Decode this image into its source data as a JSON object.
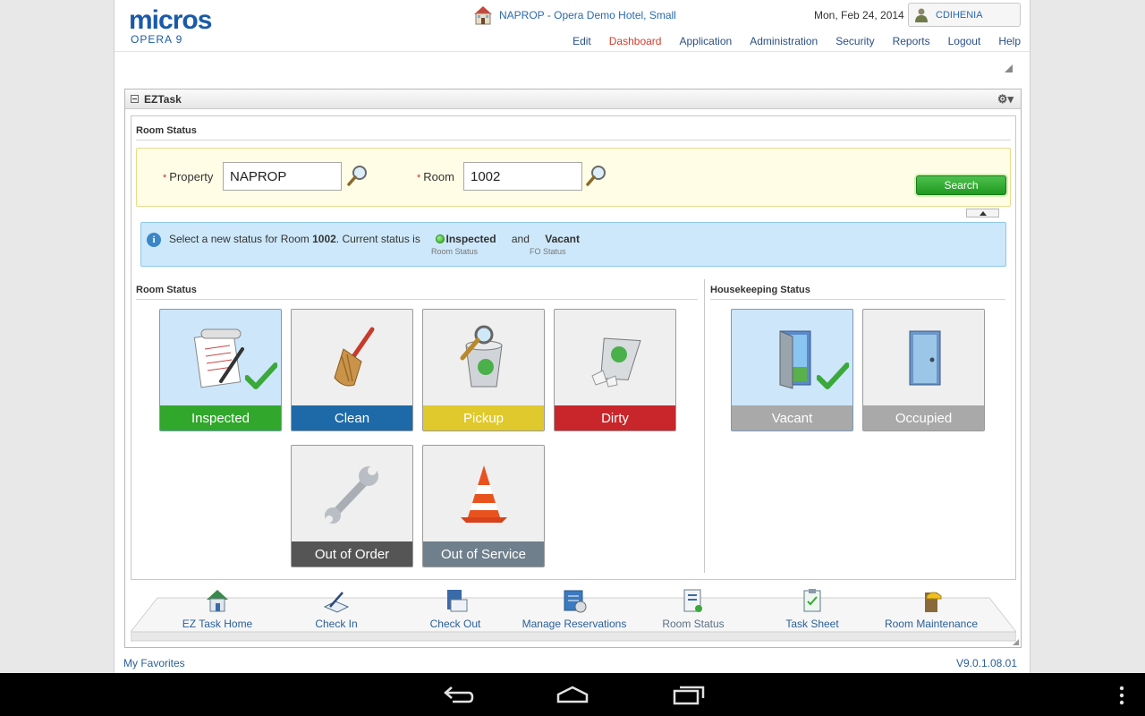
{
  "app": {
    "brand": "micros",
    "subtitle": "OPERA 9"
  },
  "header": {
    "hotel": "NAPROP - Opera Demo Hotel, Small",
    "date": "Mon, Feb 24, 2014",
    "user": "CDIHENIA",
    "nav": [
      "Edit",
      "Dashboard",
      "Application",
      "Administration",
      "Security",
      "Reports",
      "Logout",
      "Help"
    ],
    "active_nav": "Dashboard"
  },
  "panel": {
    "title": "EZTask",
    "section_title": "Room Status"
  },
  "search": {
    "property_label": "Property",
    "property_value": "NAPROP",
    "room_label": "Room",
    "room_value": "1002",
    "required_mark": "*",
    "search_button": "Search"
  },
  "info": {
    "icon": "i",
    "prefix": "Select a new status for Room",
    "room": "1002",
    "middle": ". Current status is",
    "room_status": "Inspected",
    "room_status_caption": "Room Status",
    "conjunction": "and",
    "fo_status": "Vacant",
    "fo_status_caption": "FO Status"
  },
  "room_status": {
    "title": "Room Status",
    "tiles": [
      {
        "label": "Inspected",
        "color": "#31a82b",
        "icon": "clipboard-icon",
        "selected": true
      },
      {
        "label": "Clean",
        "color": "#1e6aa8",
        "icon": "broom-icon",
        "selected": false
      },
      {
        "label": "Pickup",
        "color": "#e0c92c",
        "icon": "trash-can-icon",
        "selected": false
      },
      {
        "label": "Dirty",
        "color": "#c8262a",
        "icon": "overflowing-bin-icon",
        "selected": false
      },
      {
        "label": "Out of Order",
        "color": "#555555",
        "icon": "wrench-icon",
        "selected": false
      },
      {
        "label": "Out of Service",
        "color": "#6f7f8c",
        "icon": "traffic-cone-icon",
        "selected": false
      }
    ]
  },
  "housekeeping_status": {
    "title": "Housekeeping Status",
    "tiles": [
      {
        "label": "Vacant",
        "color": "#a9a9a9",
        "icon": "open-door-icon",
        "selected": true
      },
      {
        "label": "Occupied",
        "color": "#a9a9a9",
        "icon": "closed-door-icon",
        "selected": false
      }
    ]
  },
  "dock": [
    {
      "label": "EZ Task Home",
      "icon": "home-icon"
    },
    {
      "label": "Check In",
      "icon": "check-in-icon"
    },
    {
      "label": "Check Out",
      "icon": "check-out-icon"
    },
    {
      "label": "Manage Reservations",
      "icon": "reservations-icon"
    },
    {
      "label": "Room Status",
      "icon": "room-status-icon"
    },
    {
      "label": "Task Sheet",
      "icon": "task-sheet-icon"
    },
    {
      "label": "Room Maintenance",
      "icon": "maintenance-icon"
    }
  ],
  "footer": {
    "favorites": "My Favorites",
    "version": "V9.0.1.08.01"
  }
}
